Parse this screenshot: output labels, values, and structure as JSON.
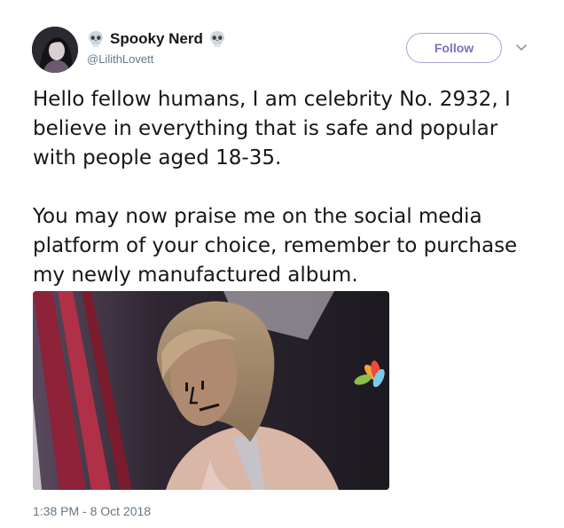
{
  "user": {
    "display_name": "Spooky Nerd",
    "handle": "@LilithLovett",
    "name_icon": "skull-icon"
  },
  "actions": {
    "follow_label": "Follow",
    "menu_icon": "chevron-down-icon"
  },
  "tweet": {
    "paragraphs": [
      "Hello fellow humans, I am celebrity No. 2932, I believe in everything that is safe and popular with people aged 18-35.",
      "You may now praise me on the social media platform of your choice, remember to purchase my newly manufactured album."
    ],
    "timestamp": "1:38 PM - 8 Oct 2018"
  },
  "colors": {
    "follow_border": "#a2a7d7",
    "follow_text": "#7a6fc4",
    "secondary_text": "#657786"
  }
}
